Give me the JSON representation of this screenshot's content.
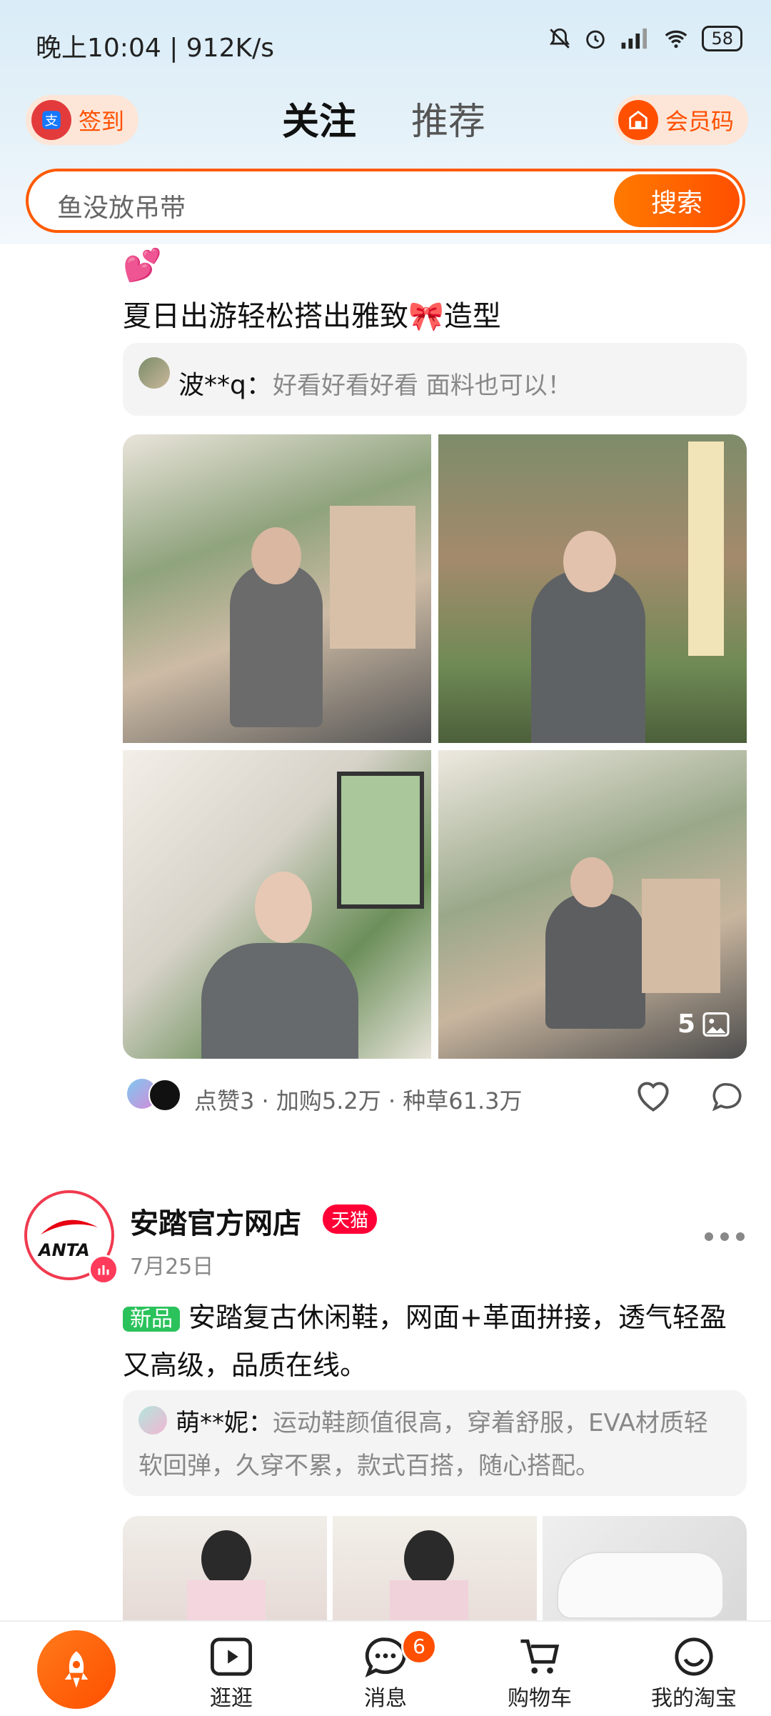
{
  "status": {
    "time": "晚上10:04 | 912K/s",
    "battery": "58"
  },
  "header": {
    "checkin_label": "签到",
    "tabs": [
      {
        "label": "关注",
        "active": true
      },
      {
        "label": "推荐",
        "active": false
      }
    ],
    "member_label": "会员码"
  },
  "search": {
    "placeholder": "鱼没放吊带",
    "button": "搜索"
  },
  "post1": {
    "emoji": "💕",
    "title": "夏日出游轻松搭出雅致🎀造型",
    "comment_user": "波**q：",
    "comment_text": "好看好看好看 面料也可以！",
    "photo_count": "5",
    "stats": "点赞3 · 加购5.2万 · 种草61.3万"
  },
  "post2": {
    "shop_name": "安踏官方网店",
    "badge": "天猫",
    "date": "7月25日",
    "logo_text": "ANTA",
    "tag": "新品",
    "desc": "安踏复古休闲鞋，网面+革面拼接，透气轻盈又高级，品质在线。",
    "comment_user": "萌**妮：",
    "comment_text": "运动鞋颜值很高，穿着舒服，EVA材质轻软回弹，久穿不累，款式百搭，随心搭配。"
  },
  "nav": {
    "items": [
      {
        "label": "逛逛"
      },
      {
        "label": "消息"
      },
      {
        "label": "购物车"
      },
      {
        "label": "我的淘宝"
      }
    ],
    "message_badge": "6"
  },
  "colors": {
    "accent": "#ff5000",
    "tmall": "#ff0036",
    "tag_green": "#2bc25b"
  }
}
